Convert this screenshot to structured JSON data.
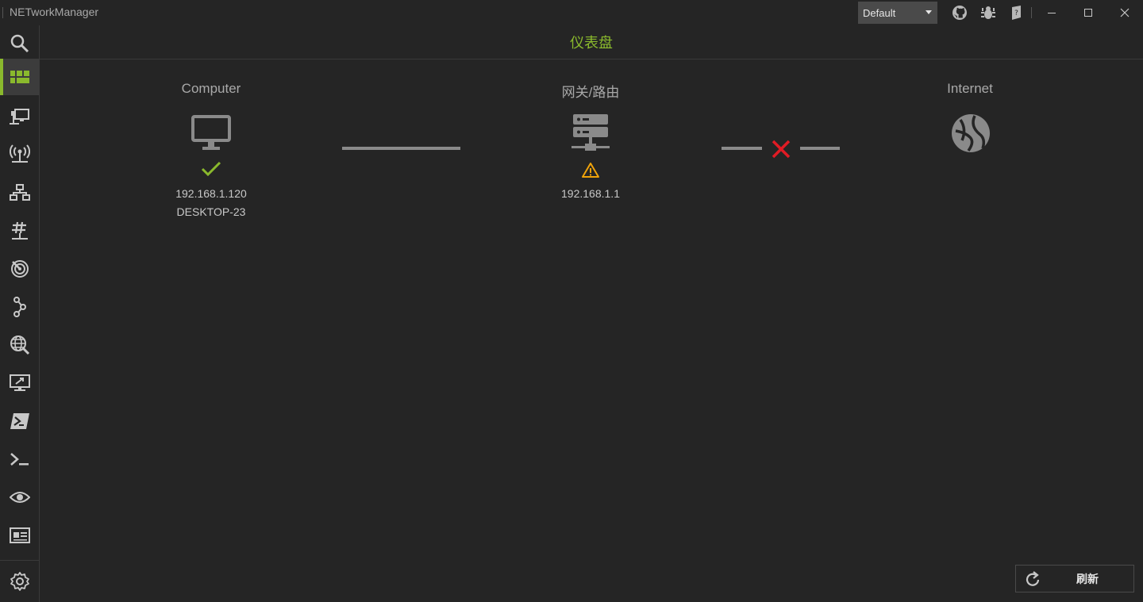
{
  "app": {
    "title": "NETworkManager"
  },
  "titlebar": {
    "profile": "Default"
  },
  "header": {
    "title": "仪表盘"
  },
  "nodes": {
    "computer": {
      "label": "Computer",
      "ip": "192.168.1.120",
      "hostname": "DESKTOP-23",
      "status": "ok"
    },
    "gateway": {
      "label": "网关/路由",
      "ip": "192.168.1.1",
      "status": "warning"
    },
    "internet": {
      "label": "Internet",
      "status": "unknown"
    }
  },
  "connections": [
    {
      "from": "computer",
      "to": "gateway",
      "status": "connected"
    },
    {
      "from": "gateway",
      "to": "internet",
      "status": "failed"
    }
  ],
  "actions": {
    "refresh_label": "刷新"
  },
  "colors": {
    "accent": "#8ab92d",
    "warning": "#f0a30a",
    "error": "#e01b24",
    "background": "#252525"
  },
  "sidebar": {
    "items": [
      {
        "icon": "search-icon"
      },
      {
        "icon": "dashboard-icon",
        "active": true
      },
      {
        "icon": "network-interface-icon"
      },
      {
        "icon": "wifi-icon"
      },
      {
        "icon": "ip-scanner-icon"
      },
      {
        "icon": "port-scanner-icon"
      },
      {
        "icon": "ping-monitor-icon"
      },
      {
        "icon": "traceroute-icon"
      },
      {
        "icon": "dns-lookup-icon"
      },
      {
        "icon": "remote-desktop-icon"
      },
      {
        "icon": "powershell-icon"
      },
      {
        "icon": "putty-terminal-icon"
      },
      {
        "icon": "tigervnc-icon"
      },
      {
        "icon": "webconsole-icon"
      },
      {
        "icon": "settings-icon"
      }
    ]
  }
}
